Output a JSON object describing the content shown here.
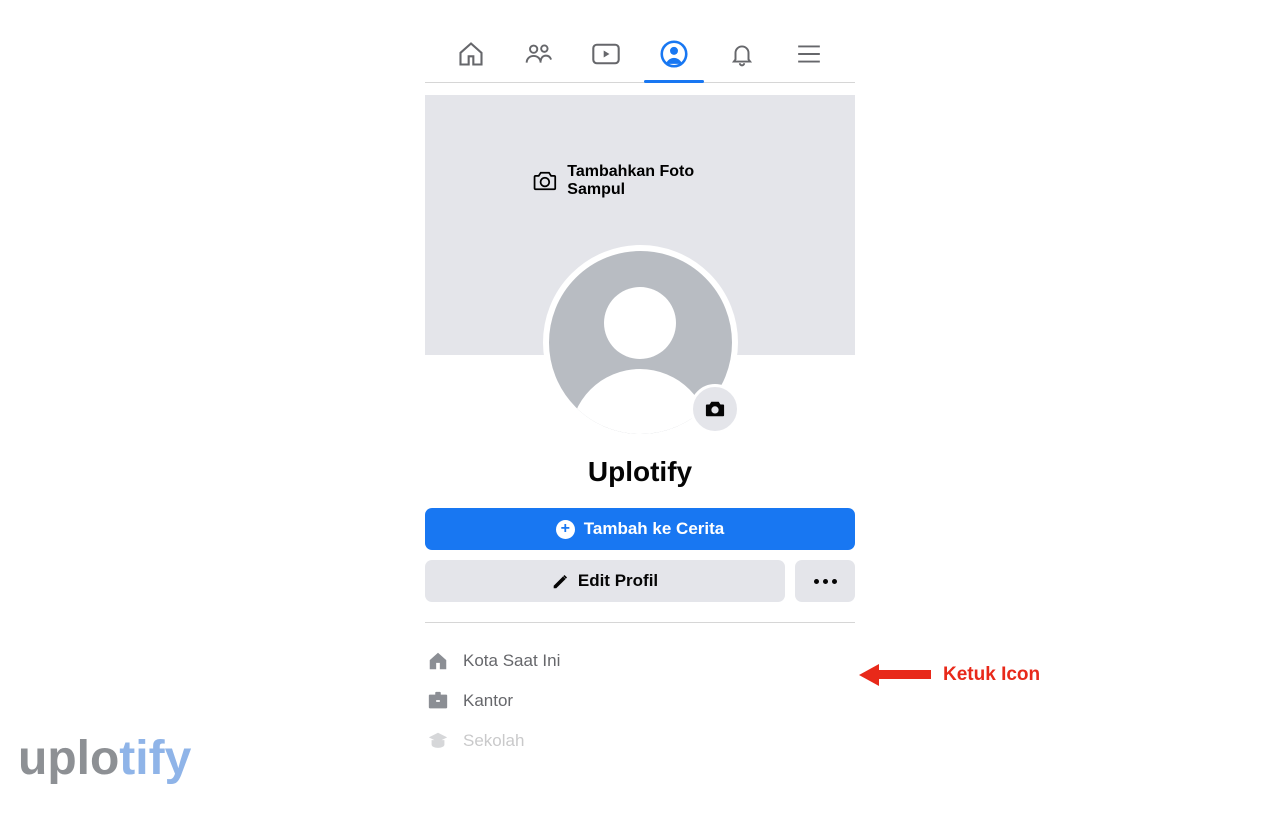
{
  "nav": {
    "tabs": [
      "home",
      "friends",
      "watch",
      "profile",
      "notifications",
      "menu"
    ],
    "active": "profile"
  },
  "cover": {
    "add_label": "Tambahkan Foto Sampul"
  },
  "profile": {
    "name": "Uplotify"
  },
  "buttons": {
    "add_story": "Tambah ke Cerita",
    "edit_profile": "Edit Profil"
  },
  "about": {
    "items": [
      {
        "icon": "home",
        "label": "Kota Saat Ini"
      },
      {
        "icon": "briefcase",
        "label": "Kantor"
      },
      {
        "icon": "gradcap",
        "label": "Sekolah"
      }
    ]
  },
  "annotation": {
    "label": "Ketuk Icon"
  },
  "watermark": {
    "pre": "uplo",
    "post": "tify"
  }
}
